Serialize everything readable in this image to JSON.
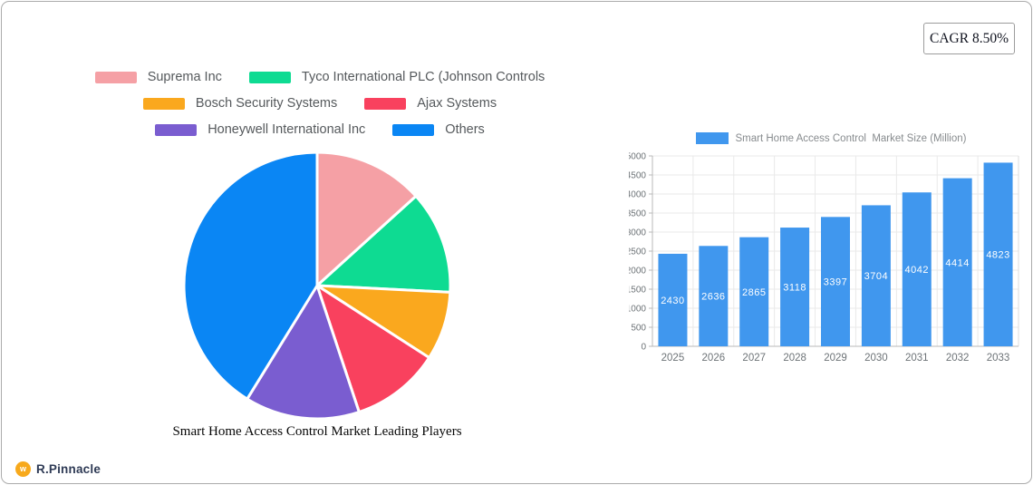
{
  "badge": {
    "cagr_label": "CAGR 8.50%"
  },
  "branding": {
    "logo_text": "R.Pinnacle",
    "logo_mark_glyph": "w",
    "logo_mark_color": "#f7a91c"
  },
  "colors": {
    "bar_blue": "#4097ee",
    "pie_blue": "#0a86f4",
    "grid_line": "#e9e9e9",
    "axis_line": "#b9b9b9",
    "plot_border": "#dcdcdc"
  },
  "chart_data": [
    {
      "type": "pie",
      "title": "Smart Home Access Control Market Leading Players",
      "labels": [
        "Suprema Inc",
        "Tyco International PLC (Johnson Controls",
        "Bosch Security Systems",
        "Ajax Systems",
        "Honeywell International Inc",
        "Others"
      ],
      "values": [
        13.3,
        12.5,
        8.3,
        10.8,
        13.9,
        41.2
      ],
      "colors": [
        "#f5a0a5",
        "#0edb92",
        "#faa81e",
        "#f9415e",
        "#7a5dd0",
        "#0a86f4"
      ],
      "legend_position": "top",
      "start_angle_deg": -90,
      "slice_border_color": "#ffffff"
    },
    {
      "type": "bar",
      "title": "Smart Home Access Control  Market Size (Million)",
      "legend_label": "Smart Home Access Control  Market Size (Million)",
      "categories": [
        "2025",
        "2026",
        "2027",
        "2028",
        "2029",
        "2030",
        "2031",
        "2032",
        "2033"
      ],
      "values": [
        2430,
        2636,
        2865,
        3118,
        3397,
        3704,
        4042,
        4414,
        4823
      ],
      "bar_color": "#4097ee",
      "value_label_color": "#ffffff",
      "ylim": [
        0,
        5000
      ],
      "y_tick_step": 500,
      "grid": true,
      "legend_position": "top"
    }
  ]
}
